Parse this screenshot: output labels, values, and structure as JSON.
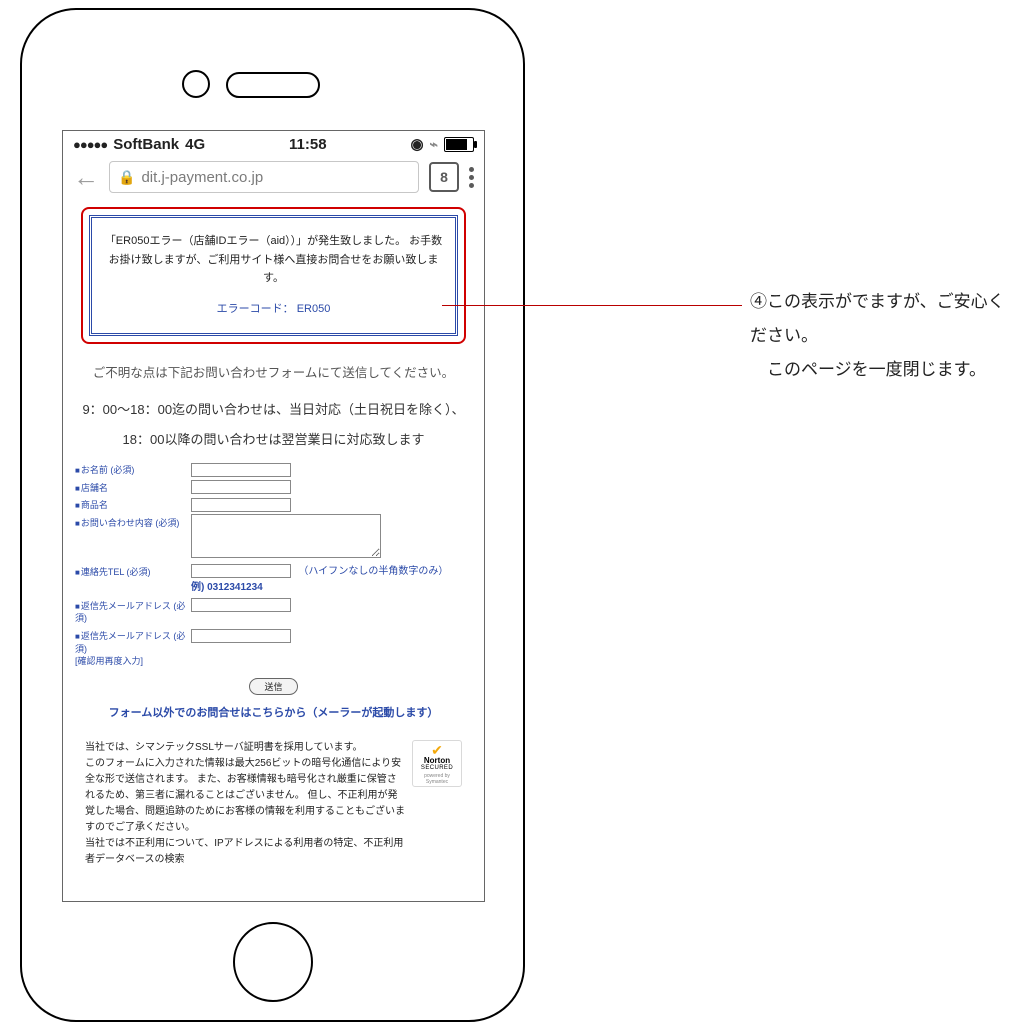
{
  "status": {
    "signal_dots": "●●●●●",
    "carrier": "SoftBank",
    "network": "4G",
    "time": "11:58",
    "alarm_icon": "⏰",
    "bluetooth_icon": "✱"
  },
  "browser": {
    "url_visible": "dit.j-payment.co.jp",
    "tab_count": "8"
  },
  "error_box": {
    "message": "「ER050エラー（店舗IDエラー（aid））」が発生致しました。 お手数お掛け致しますが、ご利用サイト様へ直接お問合せをお願い致します。",
    "code_label": "エラーコード： ER050"
  },
  "notes": {
    "contact_note": "ご不明な点は下記お問い合わせフォームにて送信してください。",
    "hours_line1": "9：00～18：00迄の問い合わせは、当日対応（土日祝日を除く）、",
    "hours_line2": "18：00以降の問い合わせは翌営業日に対応致します"
  },
  "form": {
    "labels": {
      "name": "お名前 (必須)",
      "shop": "店舗名",
      "product": "商品名",
      "inquiry": "お問い合わせ内容 (必須)",
      "tel": "連絡先TEL (必須)",
      "email1": "返信先メールアドレス (必須)",
      "email2": "返信先メールアドレス (必須)\n[確認用再度入力]"
    },
    "tel_note": "（ハイフンなしの半角数字のみ）",
    "tel_example": "例) 0312341234",
    "submit": "送信",
    "mailer_link": "フォーム以外でのお問合せはこちらから（メーラーが起動します）"
  },
  "footer": {
    "text": "当社では、シマンテックSSLサーバ証明書を採用しています。\nこのフォームに入力された情報は最大256ビットの暗号化通信により安全な形で送信されます。 また、お客様情報も暗号化され厳重に保管されるため、第三者に漏れることはございません。 但し、不正利用が発覚した場合、問題追跡のためにお客様の情報を利用することもございますのでご了承ください。\n当社では不正利用について、IPアドレスによる利用者の特定、不正利用者データベースの検索",
    "norton_brand": "Norton",
    "norton_secured": "SECURED",
    "norton_by": "powered by Symantec"
  },
  "annotation": {
    "line1": "④この表示がでますが、ご安心ください。",
    "line2": "このページを一度閉じます。"
  }
}
